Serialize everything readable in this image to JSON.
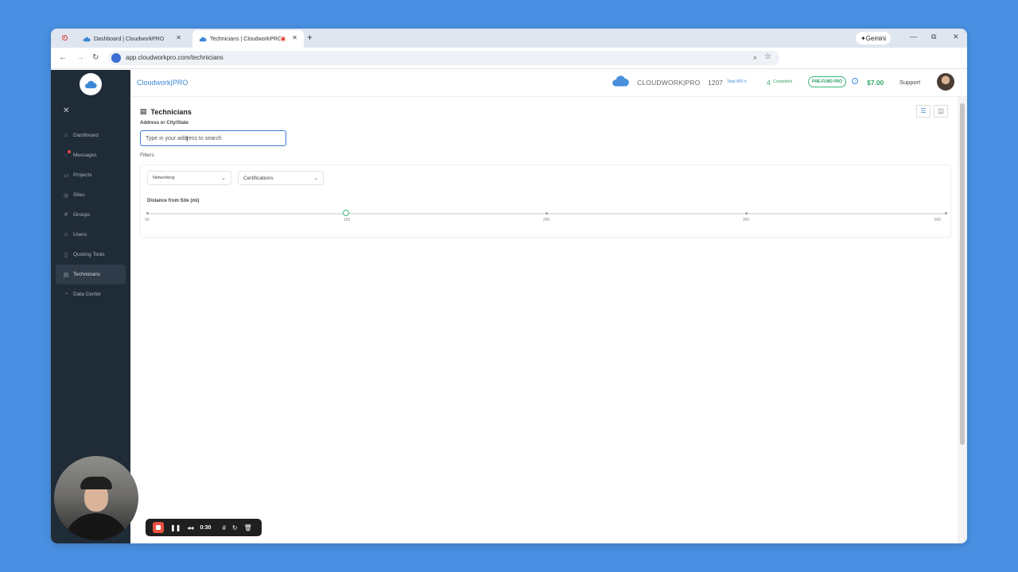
{
  "browser": {
    "tabs": [
      {
        "title": "Dashboard | CloudworkPRO",
        "active": false
      },
      {
        "title": "Technicians | CloudworkPRO",
        "active": true
      }
    ],
    "new_tab": "+",
    "url": "app.cloudworkpro.com/technicians",
    "gemini_label": "Gemini"
  },
  "topbar": {
    "brand": "Cloudwork|PRO",
    "company_name": "CLOUDWORK|PRO",
    "total_wo_count": "1207",
    "total_wo_label": "Total WO #",
    "completed_count": "4",
    "completed_label": "Completed",
    "prefund_label": "PRE-FUND PRO",
    "balance": "$7.00",
    "support": "Support"
  },
  "sidebar": {
    "items": [
      {
        "label": "Dashboard",
        "icon": "home-icon",
        "glyph": "⌂"
      },
      {
        "label": "Messages",
        "icon": "chat-icon",
        "glyph": "◌"
      },
      {
        "label": "Projects",
        "icon": "folder-icon",
        "glyph": "▭"
      },
      {
        "label": "Sites",
        "icon": "location-icon",
        "glyph": "◎"
      },
      {
        "label": "Groups",
        "icon": "hash-icon",
        "glyph": "#"
      },
      {
        "label": "Users",
        "icon": "users-icon",
        "glyph": "☺"
      },
      {
        "label": "Quoting Tools",
        "icon": "document-icon",
        "glyph": "▯"
      },
      {
        "label": "Technicians",
        "icon": "table-icon",
        "glyph": "▤"
      },
      {
        "label": "Data Center",
        "icon": "chart-icon",
        "glyph": "◔"
      }
    ],
    "active_item": "Technicians"
  },
  "main": {
    "title": "Technicians",
    "address_label": "Address or City/State",
    "search_placeholder": "Type in your address to search",
    "filters_label": "Filters",
    "filter_networking": "Networking",
    "filter_certifications": "Certifications",
    "distance_label": "Distance from Site (mi)",
    "distance_ticks": [
      "50",
      "100",
      "200",
      "300",
      "500"
    ],
    "distance_value": "100"
  },
  "recorder": {
    "time": "0:30"
  },
  "colors": {
    "background": "#4a90e2",
    "sidebar": "#1f2b37",
    "accent_blue": "#3b89d6",
    "accent_green": "#3aa86a",
    "record_red": "#e8503f"
  }
}
